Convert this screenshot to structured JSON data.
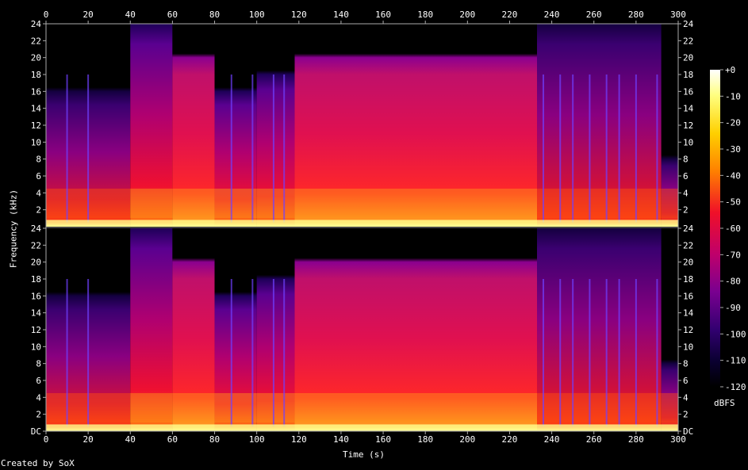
{
  "chart_data": {
    "type": "heatmap",
    "xlabel": "Time (s)",
    "ylabel": "Frequency (kHz)",
    "xlim": [
      0,
      300
    ],
    "ylim": [
      0,
      24
    ],
    "x_ticks": [
      0,
      20,
      40,
      60,
      80,
      100,
      120,
      140,
      160,
      180,
      200,
      220,
      240,
      260,
      280,
      300
    ],
    "y_ticks_top": [
      "24",
      "22",
      "20",
      "18",
      "16",
      "14",
      "12",
      "10",
      "8",
      "6",
      "4",
      "2"
    ],
    "y_ticks_bottom": [
      "24",
      "22",
      "20",
      "18",
      "16",
      "14",
      "12",
      "10",
      "8",
      "6",
      "4",
      "2",
      "DC"
    ],
    "channels": 2,
    "colorbar": {
      "label": "dBFS",
      "range": [
        -120,
        0
      ],
      "ticks": [
        "+0",
        "-10",
        "-20",
        "-30",
        "-40",
        "-50",
        "-60",
        "-70",
        "-80",
        "-90",
        "-100",
        "-110",
        "-120"
      ]
    },
    "segments": [
      {
        "start": 0,
        "end": 40,
        "cutoff_khz": 16,
        "level": "low"
      },
      {
        "start": 40,
        "end": 60,
        "cutoff_khz": 24,
        "level": "medium"
      },
      {
        "start": 60,
        "end": 80,
        "cutoff_khz": 20,
        "level": "high"
      },
      {
        "start": 80,
        "end": 100,
        "cutoff_khz": 16,
        "level": "medium"
      },
      {
        "start": 100,
        "end": 118,
        "cutoff_khz": 18,
        "level": "medium"
      },
      {
        "start": 118,
        "end": 233,
        "cutoff_khz": 20,
        "level": "high"
      },
      {
        "start": 233,
        "end": 292,
        "cutoff_khz": 24,
        "level": "low"
      },
      {
        "start": 292,
        "end": 300,
        "cutoff_khz": 8,
        "level": "low"
      }
    ],
    "transients_s": [
      10,
      20,
      88,
      98,
      108,
      113,
      236,
      244,
      250,
      258,
      266,
      272,
      280,
      290
    ]
  },
  "footer": {
    "credit": "Created by SoX"
  }
}
